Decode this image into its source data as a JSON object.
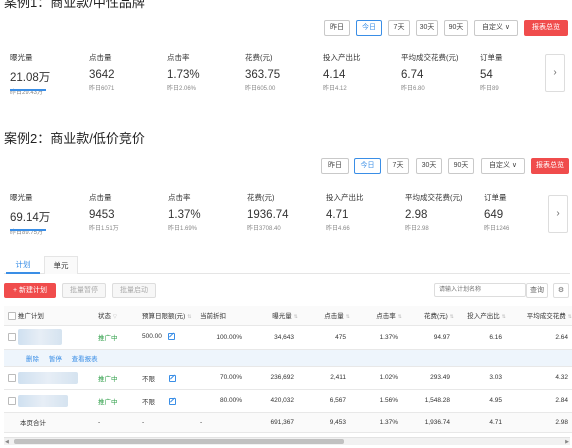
{
  "case1": {
    "title": "案例1：商业款/中性品牌",
    "toolbar": [
      "昨日",
      "今日",
      "7天",
      "30天",
      "90天",
      "自定义 ∨",
      "报表总览"
    ],
    "metrics": [
      {
        "label": "曝光量",
        "value": "21.08万",
        "prev": "昨日29.43万"
      },
      {
        "label": "点击量",
        "value": "3642",
        "prev": "昨日6071"
      },
      {
        "label": "点击率",
        "value": "1.73%",
        "prev": "昨日2.06%"
      },
      {
        "label": "花费(元)",
        "value": "363.75",
        "prev": "昨日605.00"
      },
      {
        "label": "投入产出比",
        "value": "4.14",
        "prev": "昨日4.12"
      },
      {
        "label": "平均成交花费(元)",
        "value": "6.74",
        "prev": "昨日6.80"
      },
      {
        "label": "订单量",
        "value": "54",
        "prev": "昨日89"
      }
    ]
  },
  "case2": {
    "title": "案例2：商业款/低价竞价",
    "toolbar": [
      "昨日",
      "今日",
      "7天",
      "30天",
      "90天",
      "自定义 ∨",
      "报表总览"
    ],
    "metrics": [
      {
        "label": "曝光量",
        "value": "69.14万",
        "prev": "昨日89.75万"
      },
      {
        "label": "点击量",
        "value": "9453",
        "prev": "昨日1.51万"
      },
      {
        "label": "点击率",
        "value": "1.37%",
        "prev": "昨日1.69%"
      },
      {
        "label": "花费(元)",
        "value": "1936.74",
        "prev": "昨日3708.40"
      },
      {
        "label": "投入产出比",
        "value": "4.71",
        "prev": "昨日4.66"
      },
      {
        "label": "平均成交花费(元)",
        "value": "2.98",
        "prev": "昨日2.98"
      },
      {
        "label": "订单量",
        "value": "649",
        "prev": "昨日1246"
      }
    ]
  },
  "tabs": [
    "计划",
    "单元"
  ],
  "buttons": {
    "new": "+ 新建计划",
    "pause": "批量暂停",
    "start": "批量启动"
  },
  "search": {
    "placeholder": "请输入计划名称",
    "button": "查询"
  },
  "table": {
    "headers": [
      "推广计划",
      "状态",
      "预算日限额(元)",
      "当前折扣",
      "曝光量",
      "点击量",
      "点击率",
      "花费(元)",
      "投入产出比",
      "平均成交花费"
    ],
    "rows": [
      {
        "status": "推广中",
        "budget": "500.00",
        "discount": "100.00%",
        "impressions": "34,643",
        "clicks": "475",
        "ctr": "1.37%",
        "cost": "94.97",
        "roi": "6.16",
        "avg": "2.64"
      },
      {
        "status": "推广中",
        "budget": "不限",
        "discount": "70.00%",
        "impressions": "236,692",
        "clicks": "2,411",
        "ctr": "1.02%",
        "cost": "293.49",
        "roi": "3.03",
        "avg": "4.32"
      },
      {
        "status": "推广中",
        "budget": "不限",
        "discount": "80.00%",
        "impressions": "420,032",
        "clicks": "6,567",
        "ctr": "1.56%",
        "cost": "1,548.28",
        "roi": "4.95",
        "avg": "2.84"
      }
    ],
    "row_actions": [
      "删除",
      "暂停",
      "查看报表"
    ],
    "total": {
      "label": "本页合计",
      "status": "-",
      "budget": "-",
      "discount": "-",
      "impressions": "691,367",
      "clicks": "9,453",
      "ctr": "1.37%",
      "cost": "1,936.74",
      "roi": "4.71",
      "avg": "2.98"
    }
  }
}
